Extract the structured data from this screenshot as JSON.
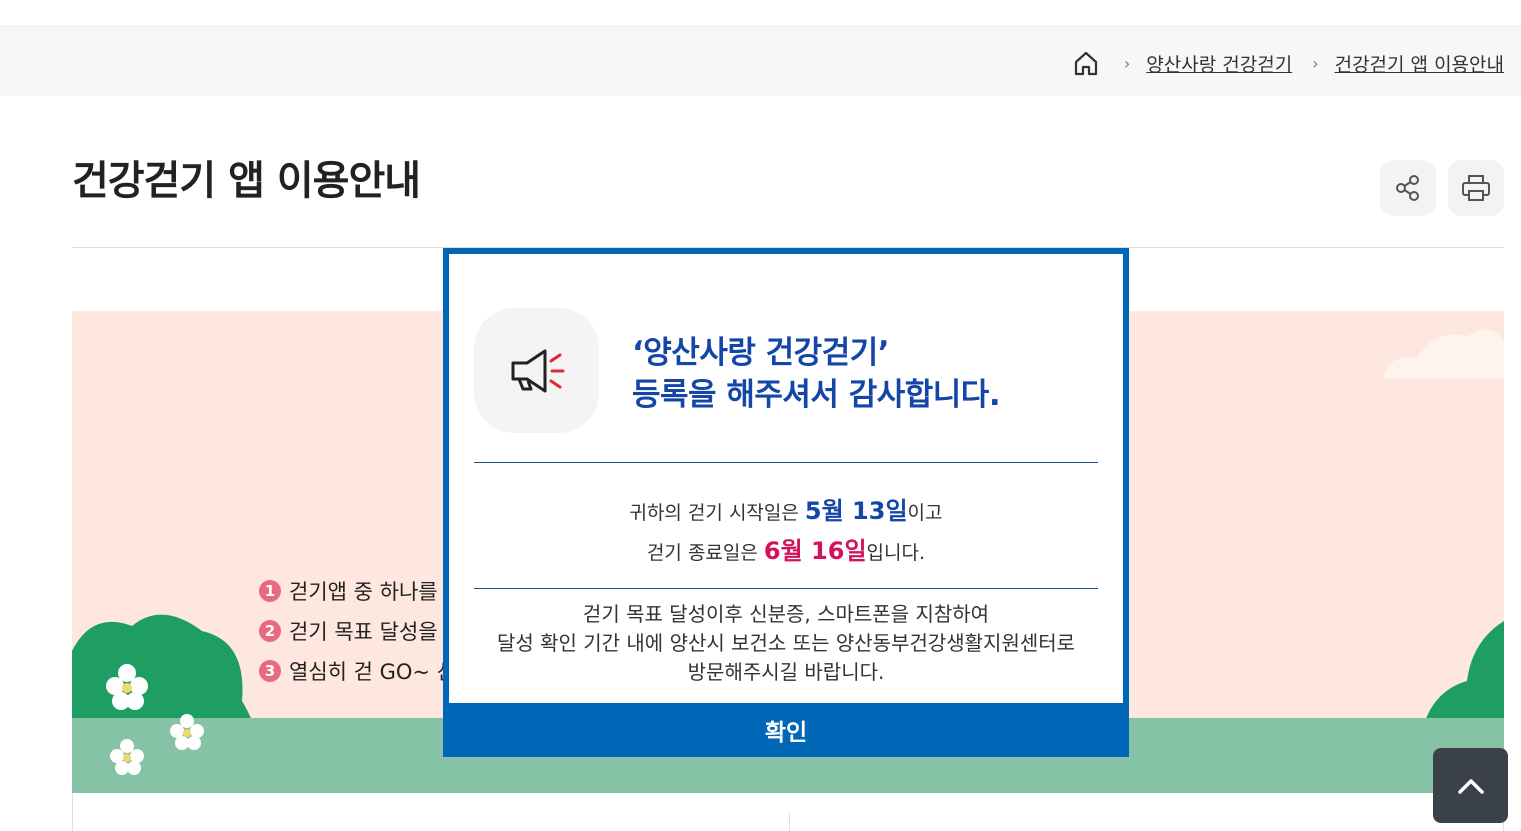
{
  "breadcrumb": {
    "items": [
      "양산사랑 건강걷기",
      "건강걷기 앱 이용안내"
    ]
  },
  "page": {
    "title": "건강걷기 앱 이용안내"
  },
  "banner": {
    "steps": [
      {
        "num": "1",
        "text": "걷기앱 중 하나를"
      },
      {
        "num": "2",
        "text": "걷기 목표 달성을"
      },
      {
        "num": "3",
        "text": "열심히 걷 GO~ 산"
      }
    ]
  },
  "modal": {
    "headline_line1": "‘양산사랑 건강걷기’",
    "headline_line2": "등록을 해주셔서 감사합니다.",
    "start_prefix": "귀하의 걷기 시작일은 ",
    "start_date": "5월 13일",
    "start_suffix": "이고",
    "end_prefix": "걷기 종료일은 ",
    "end_date": "6월 16일",
    "end_suffix": "입니다.",
    "note_line1": "걷기 목표 달성이후 신분증, 스마트폰을 지참하여",
    "note_line2": "달성 확인 기간 내에 양산시 보건소 또는 양산동부건강생활지원센터로",
    "note_line3": "방문해주시길 바랍니다.",
    "confirm_label": "확인"
  },
  "colors": {
    "accent_blue": "#0066b6",
    "headline_blue": "#1446a8",
    "end_date_pink": "#d1135e",
    "banner_bg": "#fde7de"
  }
}
